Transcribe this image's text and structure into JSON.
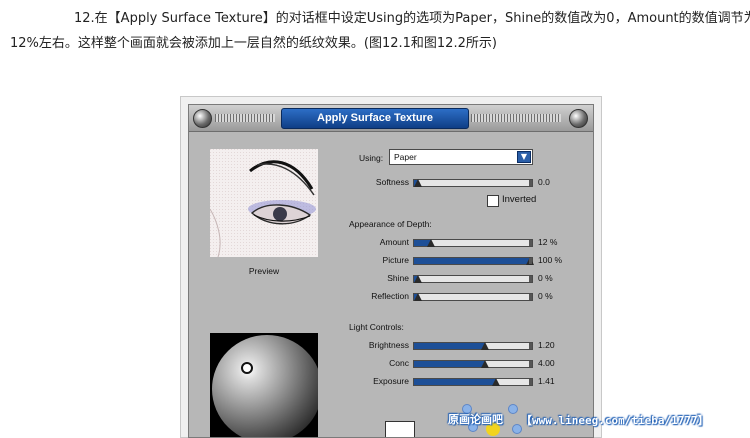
{
  "article": {
    "line1": "12.在【Apply Surface Texture】的对话框中设定Using的选项为Paper，Shine的数值改为0，Amount的数值调节为",
    "line2": "12%左右。这样整个画面就会被添加上一层自然的纸纹效果。(图12.1和图12.2所示)"
  },
  "dialog": {
    "title": "Apply Surface Texture",
    "preview_label": "Preview",
    "using_label": "Using:",
    "using_value": "Paper",
    "softness": {
      "label": "Softness",
      "value_text": "0.0",
      "level": 0
    },
    "inverted_label": "Inverted",
    "inverted_checked": false,
    "depth_heading": "Appearance of Depth:",
    "depth_rows": [
      {
        "label": "Amount",
        "value_text": "12 %",
        "level": 0.12
      },
      {
        "label": "Picture",
        "value_text": "100 %",
        "level": 1.0
      },
      {
        "label": "Shine",
        "value_text": "0 %",
        "level": 0
      },
      {
        "label": "Reflection",
        "value_text": "0 %",
        "level": 0
      }
    ],
    "light_heading": "Light Controls:",
    "light_rows": [
      {
        "label": "Brightness",
        "value_text": "1.20",
        "level": 0.6
      },
      {
        "label": "Conc",
        "value_text": "4.00",
        "level": 0.6
      },
      {
        "label": "Exposure",
        "value_text": "1.41",
        "level": 0.7
      }
    ]
  },
  "watermark": {
    "logo": "原画论画吧",
    "url": "【www.lineeg.com/tieba/1777】"
  },
  "colors": {
    "title_bar_blue": "#1f5fb5",
    "slider_fill": "#1d4f97",
    "panel_gray": "#b7b7b7"
  },
  "icons": [
    "window-ball-icon",
    "close-ball-icon",
    "dropdown-arrow-icon",
    "slider-knob-icon",
    "light-source-dot-icon"
  ]
}
